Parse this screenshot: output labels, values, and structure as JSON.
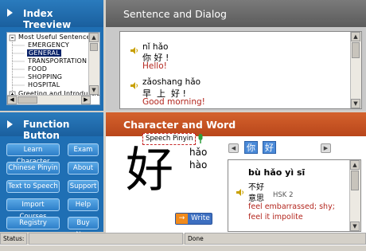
{
  "index_treeview": {
    "title": "Index Treeview",
    "root": "Most Useful Sentences",
    "items": [
      "EMERGENCY",
      "GENERAL",
      "TRANSPORTATION",
      "FOOD",
      "SHOPPING",
      "HOSPITAL"
    ],
    "selected": "GENERAL",
    "next_cut": "Greeting and Introduction"
  },
  "sentence_dialog": {
    "title": "Sentence and Dialog",
    "entries": [
      {
        "pinyin": "nǐ hǎo",
        "hanzi": "你 好 !",
        "english": "Hello!"
      },
      {
        "pinyin": "zǎoshang hǎo",
        "hanzi": "早  上  好 !",
        "english": "Good morning!"
      }
    ]
  },
  "function_button": {
    "title": "Function Button",
    "buttons": [
      "Learn Character",
      "Exam",
      "Chinese Pinyin",
      "About",
      "Text to Speech",
      "Support",
      "Import Courses",
      "Help",
      "Registry",
      "Buy Now"
    ]
  },
  "character_word": {
    "title": "Character and Word",
    "speech_pinyin_label": "Speech Pinyin",
    "big_char": "好",
    "readings": [
      "hǎo",
      "hào"
    ],
    "related_chars": [
      "你",
      "好"
    ],
    "write_label": "Write",
    "word": {
      "pinyin": "bù hǎo yì sī",
      "hanzi_line1": "不好",
      "hanzi_line2": "意思",
      "hsk": "HSK 2",
      "meaning": [
        "feel embarrassed; shy;",
        "feel it impolite"
      ]
    }
  },
  "status_bar": {
    "label": "Status:",
    "state": "Done"
  },
  "colors": {
    "blue_header": "#1a5f9e",
    "orange_header": "#c4501f",
    "panel_blue": "#1f6fb4",
    "accent_red": "#b3261e"
  }
}
